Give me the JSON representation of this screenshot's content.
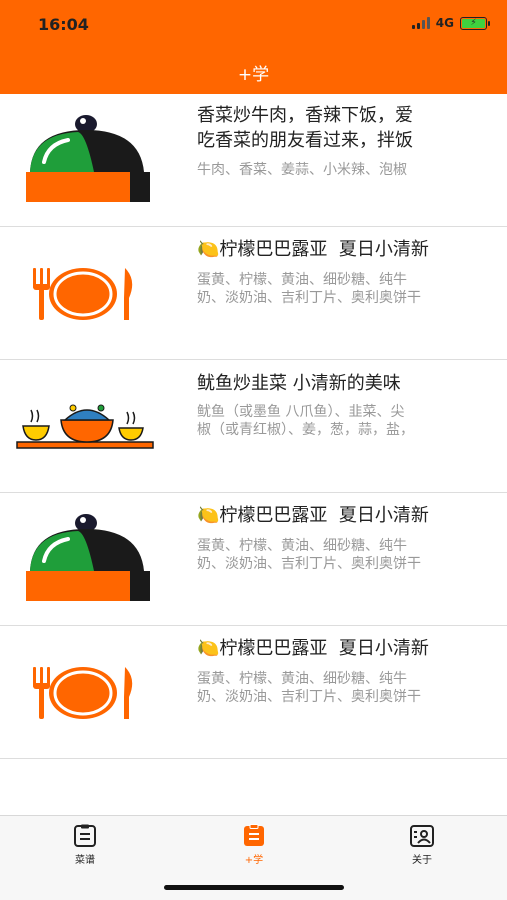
{
  "status_bar": {
    "time": "16:04",
    "network": "4G",
    "battery_icon": "battery-charging-icon"
  },
  "nav": {
    "title": "+学"
  },
  "colors": {
    "accent": "#ff6600",
    "dome": "#1f9e3a",
    "muted": "#999999"
  },
  "recipes": [
    {
      "title": "香菜炒牛肉，香辣下饭，爱\n吃香菜的朋友看过来，拌饭",
      "ingredients": "牛肉、香菜、姜蒜、小米辣、泡椒",
      "icon": "serving-cloche-icon"
    },
    {
      "title": "🍋柠檬巴巴露亚  夏日小清新",
      "ingredients": "蛋黄、柠檬、黄油、细砂糖、纯牛\n奶、淡奶油、吉利丁片、奥利奥饼干",
      "icon": "plate-fork-knife-icon"
    },
    {
      "title": "鱿鱼炒韭菜 小清新的美味",
      "ingredients": "鱿鱼（或墨鱼 八爪鱼）、韭菜、尖\n椒（或青红椒）、姜，葱，蒜，盐，",
      "icon": "food-bowls-icon"
    },
    {
      "title": "🍋柠檬巴巴露亚  夏日小清新",
      "ingredients": "蛋黄、柠檬、黄油、细砂糖、纯牛\n奶、淡奶油、吉利丁片、奥利奥饼干",
      "icon": "serving-cloche-icon"
    },
    {
      "title": "🍋柠檬巴巴露亚  夏日小清新",
      "ingredients": "蛋黄、柠檬、黄油、细砂糖、纯牛\n奶、淡奶油、吉利丁片、奥利奥饼干",
      "icon": "plate-fork-knife-icon"
    }
  ],
  "tabs": [
    {
      "label": "菜谱",
      "icon": "recipe-list-icon",
      "active": false
    },
    {
      "label": "+学",
      "icon": "clipboard-icon",
      "active": true
    },
    {
      "label": "关于",
      "icon": "profile-card-icon",
      "active": false
    }
  ]
}
